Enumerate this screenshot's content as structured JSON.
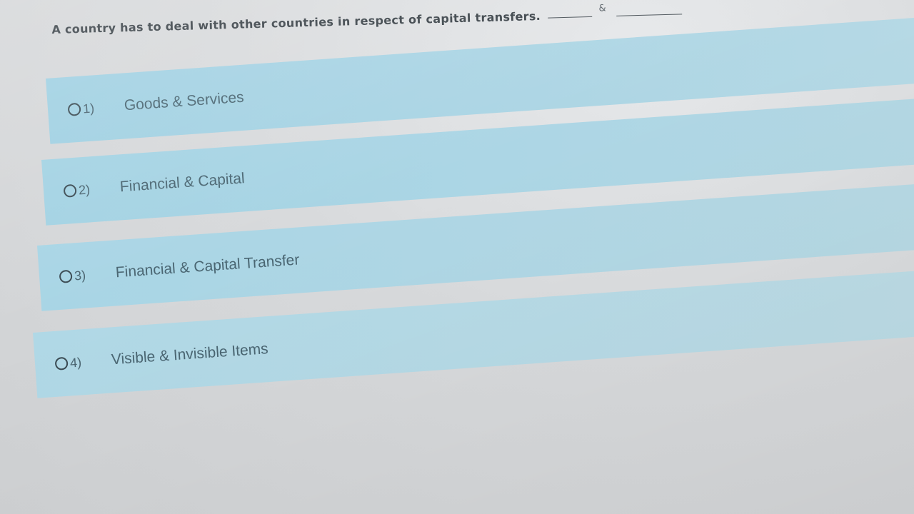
{
  "question": {
    "text": "A country has to deal with other countries in respect of capital transfers.",
    "amp": "&"
  },
  "options": [
    {
      "number": "1)",
      "label": "Goods & Services"
    },
    {
      "number": "2)",
      "label": "Financial & Capital"
    },
    {
      "number": "3)",
      "label": "Financial & Capital Transfer"
    },
    {
      "number": "4)",
      "label": "Visible & Invisible Items"
    }
  ],
  "colors": {
    "option_bg": "#a9d4e4",
    "text": "#4a6672",
    "question_text": "#3a4248"
  },
  "icons": {
    "radio": "radio-button-icon"
  }
}
